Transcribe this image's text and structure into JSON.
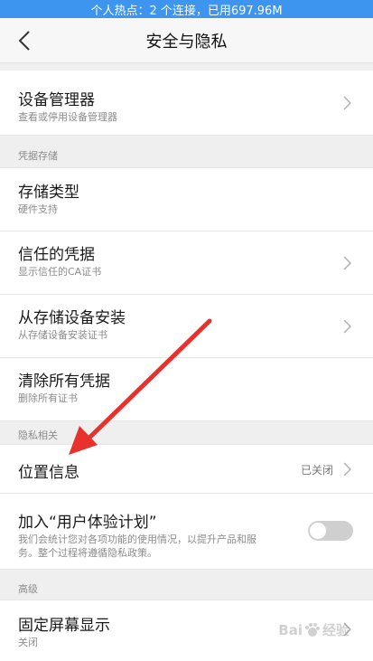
{
  "status_bar": {
    "text": "个人热点：2 个连接，已用697.96M"
  },
  "header": {
    "title": "安全与隐私",
    "back_icon": "chevron-left-icon"
  },
  "rows": {
    "device_admin": {
      "title": "设备管理器",
      "subtitle": "查看或停用设备管理器"
    },
    "storage_type": {
      "title": "存储类型",
      "subtitle": "硬件支持"
    },
    "trusted_creds": {
      "title": "信任的凭据",
      "subtitle": "显示信任的CA证书"
    },
    "install_from_storage": {
      "title": "从存储设备安装",
      "subtitle": "从存储设备安装证书"
    },
    "clear_creds": {
      "title": "清除所有凭据",
      "subtitle": "删除所有证书"
    },
    "location": {
      "title": "位置信息",
      "value": "已关闭"
    },
    "ux_plan": {
      "title": "加入“用户体验计划”",
      "subtitle_line1": "我们会统计您对各项功能的使用情况，以提升产品和服",
      "subtitle_line2": "务。整个过程将遵循隐私政策。",
      "toggle_on": false
    },
    "screen_pinning": {
      "title": "固定屏幕显示",
      "subtitle": "关闭"
    }
  },
  "sections": {
    "credentials": "凭据存储",
    "privacy": "隐私相关",
    "advanced": "高级"
  },
  "colors": {
    "status_bar": "#3d95f0",
    "annotation_arrow": "#e8302c",
    "section_bg": "#efefef"
  },
  "watermark": {
    "text": "Bai",
    "suffix": "经验"
  }
}
